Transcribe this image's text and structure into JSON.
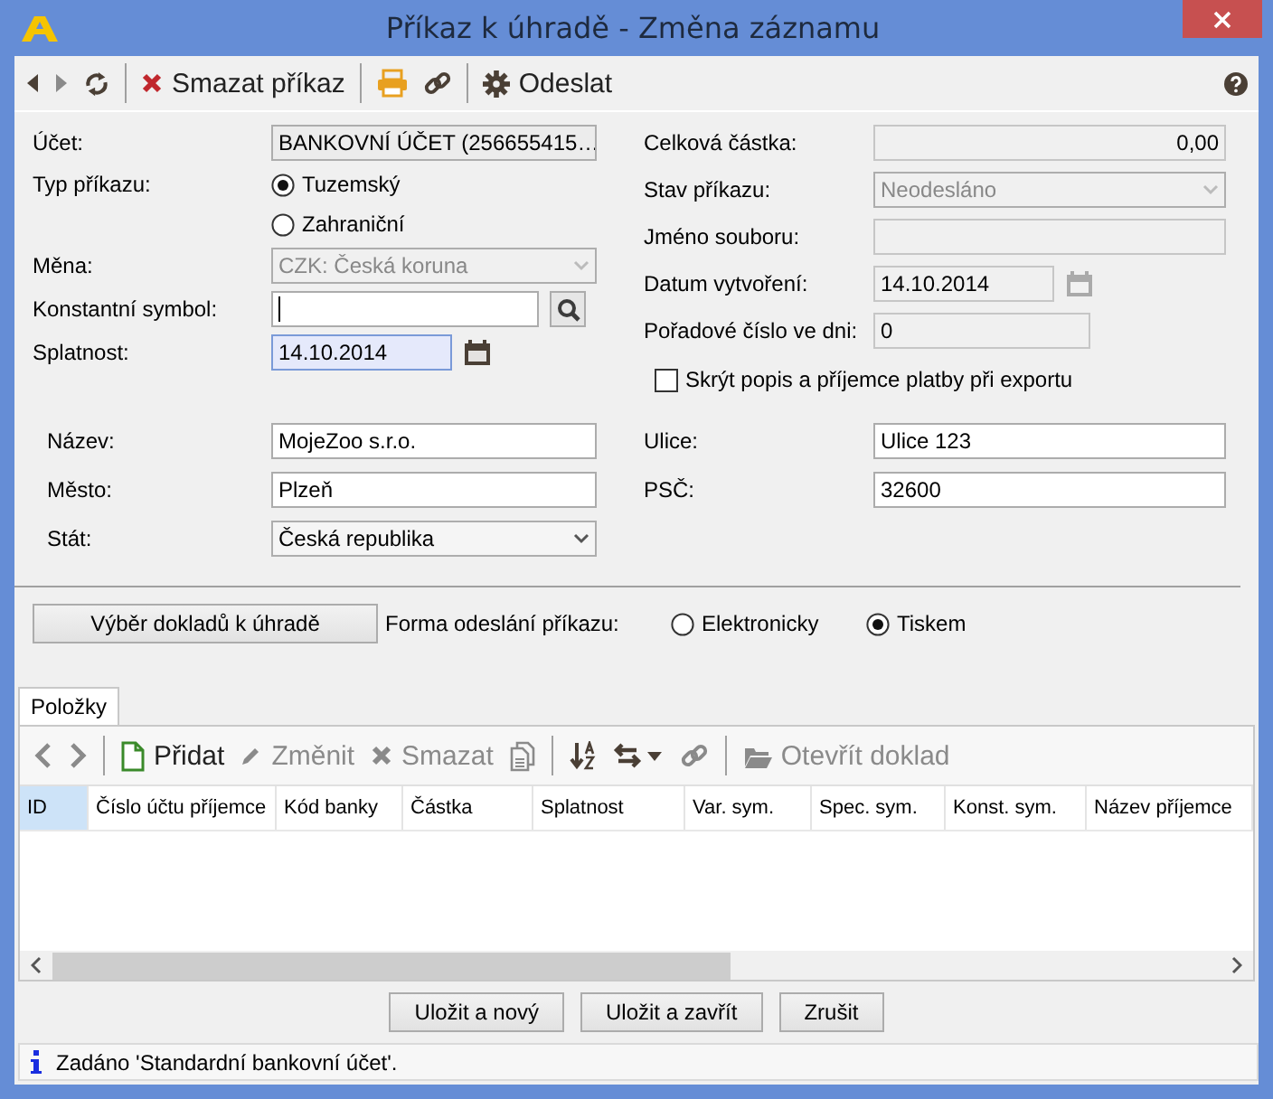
{
  "window": {
    "title": "Příkaz k úhradě - Změna záznamu"
  },
  "toolbar": [
    {
      "kind": "back",
      "disabled": false
    },
    {
      "kind": "forward",
      "disabled": true
    },
    {
      "kind": "refresh",
      "disabled": false
    },
    {
      "kind": "separator"
    },
    {
      "kind": "delete",
      "label": "Smazat příkaz",
      "disabled": false
    },
    {
      "kind": "separator"
    },
    {
      "kind": "print",
      "disabled": false
    },
    {
      "kind": "link",
      "disabled": false
    },
    {
      "kind": "separator"
    },
    {
      "kind": "send",
      "label": "Odeslat",
      "disabled": false
    },
    {
      "kind": "help",
      "disabled": false
    }
  ],
  "left_fields": [
    {
      "kind": "select",
      "label": "Účet:",
      "value": "BANKOVNÍ ÚČET (256655415…",
      "disabled": false
    },
    {
      "kind": "radio",
      "label": "Typ příkazu:",
      "options": [
        {
          "label": "Tuzemský",
          "selected": true
        },
        {
          "label": "Zahraniční",
          "selected": false
        }
      ]
    },
    {
      "kind": "select",
      "label": "Měna:",
      "value": "CZK: Česká koruna",
      "disabled": true
    },
    {
      "kind": "lookup",
      "label": "Konstantní symbol:",
      "focused": true,
      "disabled": false
    },
    {
      "kind": "date",
      "label": "Splatnost:",
      "value": "14.10.2014",
      "highlighted": true,
      "disabled": false
    }
  ],
  "right_fields": [
    {
      "kind": "amount",
      "label": "Celková částka:",
      "value": "0,00",
      "disabled": true
    },
    {
      "kind": "select",
      "label": "Stav příkazu:",
      "value": "Neodesláno",
      "disabled": true
    },
    {
      "kind": "text",
      "label": "Jméno souboru:",
      "disabled": true
    },
    {
      "kind": "date",
      "label": "Datum vytvoření:",
      "value": "14.10.2014",
      "highlighted": false,
      "disabled": true
    },
    {
      "kind": "short",
      "label": "Pořadové číslo ve dni:",
      "value": "0",
      "disabled": true
    },
    {
      "kind": "checkbox",
      "label": "Skrýt popis a příjemce platby při exportu",
      "checked": false
    }
  ],
  "address_left": [
    {
      "kind": "text",
      "label": "Název:",
      "value": "MojeZoo s.r.o.",
      "disabled": false
    },
    {
      "kind": "text",
      "label": "Město:",
      "value": "Plzeň",
      "disabled": false
    },
    {
      "kind": "select",
      "label": "Stát:",
      "value": "Česká republika",
      "disabled": false
    }
  ],
  "address_right": [
    {
      "kind": "text",
      "label": "Ulice:",
      "value": "Ulice 123",
      "disabled": false
    },
    {
      "kind": "text",
      "label": "PSČ:",
      "value": "32600",
      "disabled": false
    }
  ],
  "select_button": "Výběr dokladů k úhradě",
  "send_form": {
    "label": "Forma odeslání příkazu:",
    "options": [
      {
        "label": "Elektronicky",
        "selected": false
      },
      {
        "label": "Tiskem",
        "selected": true
      }
    ]
  },
  "tabs": [
    {
      "label": "Položky",
      "selected": true
    }
  ],
  "items_toolbar": [
    {
      "kind": "back",
      "disabled": true
    },
    {
      "kind": "forward",
      "disabled": true
    },
    {
      "kind": "separator"
    },
    {
      "kind": "add",
      "label": "Přidat",
      "disabled": false
    },
    {
      "kind": "edit",
      "label": "Změnit",
      "disabled": true
    },
    {
      "kind": "delete",
      "label": "Smazat",
      "disabled": true
    },
    {
      "kind": "copy",
      "disabled": true
    },
    {
      "kind": "separator"
    },
    {
      "kind": "sort",
      "disabled": false
    },
    {
      "kind": "swap",
      "disabled": false
    },
    {
      "kind": "link",
      "disabled": true
    },
    {
      "kind": "separator"
    },
    {
      "kind": "open",
      "label": "Otevřít doklad",
      "disabled": true
    }
  ],
  "table": {
    "columns": [
      {
        "label": "ID",
        "selected": true
      },
      {
        "label": "Číslo účtu příjemce",
        "selected": false
      },
      {
        "label": "Kód banky",
        "selected": false
      },
      {
        "label": "Částka",
        "selected": false
      },
      {
        "label": "Splatnost",
        "selected": false
      },
      {
        "label": "Var. sym.",
        "selected": false
      },
      {
        "label": "Spec. sym.",
        "selected": false
      },
      {
        "label": "Konst. sym.",
        "selected": false
      },
      {
        "label": "Název příjemce",
        "selected": false
      }
    ]
  },
  "buttons": [
    "Uložit a nový",
    "Uložit a zavřít",
    "Zrušit"
  ],
  "status_bar": "Zadáno 'Standardní bankovní účet'."
}
